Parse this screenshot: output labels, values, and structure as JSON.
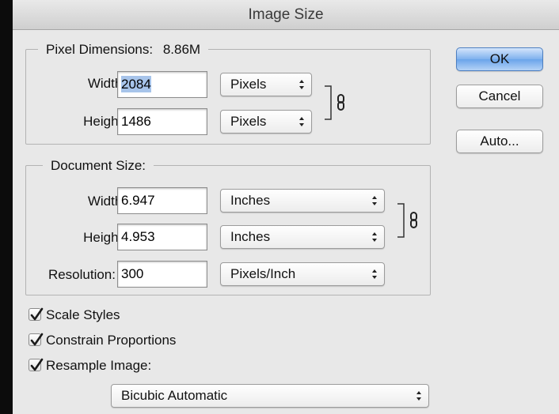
{
  "dialog": {
    "title": "Image Size"
  },
  "pixel_dimensions": {
    "legend": "Pixel Dimensions:",
    "size": "8.86M",
    "width_label": "Width:",
    "width_value_selected": "2084",
    "width_unit": "Pixels",
    "height_label": "Height:",
    "height_value": "1486",
    "height_unit": "Pixels"
  },
  "document_size": {
    "legend": "Document Size:",
    "width_label": "Width:",
    "width_value": "6.947",
    "width_unit": "Inches",
    "height_label": "Height:",
    "height_value": "4.953",
    "height_unit": "Inches",
    "resolution_label": "Resolution:",
    "resolution_value": "300",
    "resolution_unit": "Pixels/Inch"
  },
  "buttons": {
    "ok": "OK",
    "cancel": "Cancel",
    "auto": "Auto..."
  },
  "options": {
    "scale_styles": "Scale Styles",
    "constrain_proportions": "Constrain Proportions",
    "resample_image": "Resample Image:",
    "resample_method": "Bicubic Automatic"
  },
  "checkbox_states": {
    "scale_styles": true,
    "constrain_proportions": true,
    "resample_image": true
  },
  "icons": {
    "link": "chain-link-icon",
    "popup_arrows": "up-down-arrows-icon",
    "check": "checkmark-icon"
  },
  "colors": {
    "ok_button": "#7fb1ee",
    "selection": "#a7c4ea",
    "dialog_bg": "#e8e8e8"
  }
}
